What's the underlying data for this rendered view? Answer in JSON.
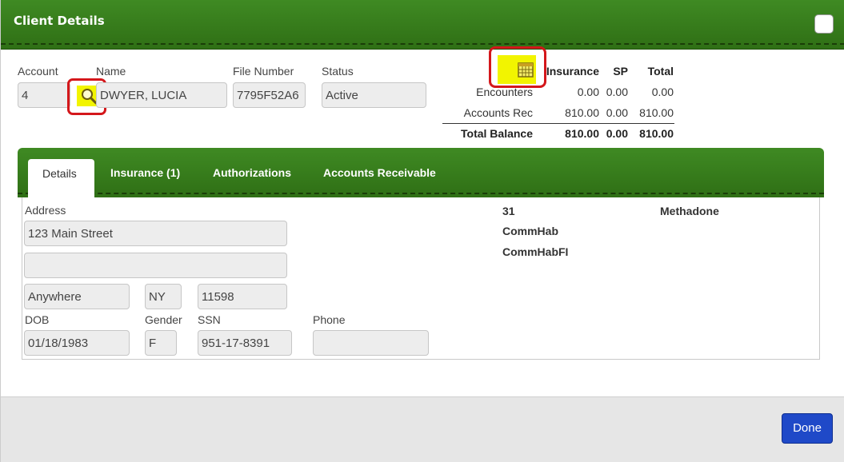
{
  "dialog": {
    "title": "Client Details"
  },
  "client": {
    "account_label": "Account",
    "account_value": "4",
    "name_label": "Name",
    "name_value": "DWYER, LUCIA",
    "file_label": "File Number",
    "file_value": "7795F52A6",
    "status_label": "Status",
    "status_value": "Active"
  },
  "summary": {
    "headers": [
      "Insurance",
      "SP",
      "Total"
    ],
    "rows": [
      {
        "label": "Encounters",
        "insurance": "0.00",
        "sp": "0.00",
        "total": "0.00"
      },
      {
        "label": "Accounts Rec",
        "insurance": "810.00",
        "sp": "0.00",
        "total": "810.00"
      }
    ],
    "total": {
      "label": "Total Balance",
      "insurance": "810.00",
      "sp": "0.00",
      "total": "810.00"
    }
  },
  "tabs": [
    "Details",
    "Insurance (1)",
    "Authorizations",
    "Accounts Receivable"
  ],
  "details": {
    "address_label": "Address",
    "address1": "123 Main Street",
    "address2": "",
    "city": "Anywhere",
    "state": "NY",
    "zip": "11598",
    "dob_label": "DOB",
    "dob": "01/18/1983",
    "gender_label": "Gender",
    "gender": "F",
    "ssn_label": "SSN",
    "ssn": "951-17-8391",
    "phone_label": "Phone",
    "phone": ""
  },
  "programs": {
    "col1": [
      "31",
      "CommHab",
      "CommHabFI"
    ],
    "col2": [
      "Methadone"
    ]
  },
  "footer": {
    "done_label": "Done"
  },
  "colors": {
    "header_green": "#3f8a23",
    "highlight": "#f2f400",
    "annotation_red": "#d4171b",
    "done_blue": "#1f49c8"
  },
  "icons": {
    "search": "magnifier-icon",
    "calendar": "calendar-icon"
  }
}
